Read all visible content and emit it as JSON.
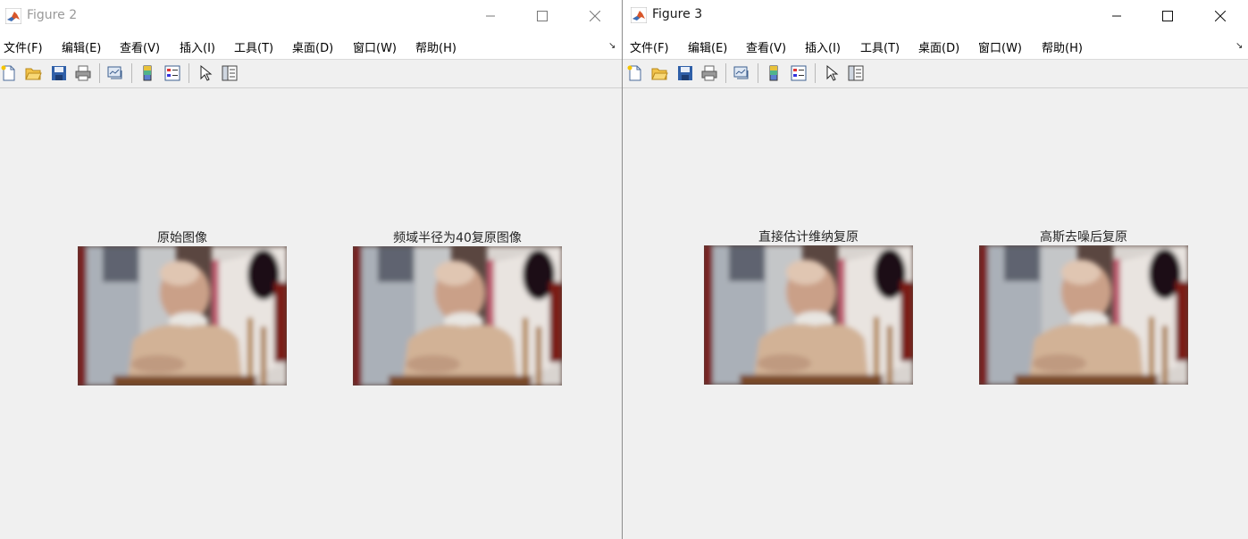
{
  "figures": [
    {
      "title": "Figure 2",
      "menu": [
        "文件(F)",
        "编辑(E)",
        "查看(V)",
        "插入(I)",
        "工具(T)",
        "桌面(D)",
        "窗口(W)",
        "帮助(H)"
      ],
      "menu_overflow": "↘",
      "toolbar_icons": [
        "new-figure-icon",
        "open-file-icon",
        "save-icon",
        "print-icon",
        "link-plot-icon",
        "insert-colorbar-icon",
        "insert-legend-icon",
        "edit-plot-arrow-icon",
        "property-inspector-icon"
      ],
      "subplots": [
        {
          "title": "原始图像"
        },
        {
          "title": "频域半径为40复原图像"
        }
      ]
    },
    {
      "title": "Figure 3",
      "menu": [
        "文件(F)",
        "编辑(E)",
        "查看(V)",
        "插入(I)",
        "工具(T)",
        "桌面(D)",
        "窗口(W)",
        "帮助(H)"
      ],
      "menu_overflow": "↘",
      "toolbar_icons": [
        "new-figure-icon",
        "open-file-icon",
        "save-icon",
        "print-icon",
        "link-plot-icon",
        "insert-colorbar-icon",
        "insert-legend-icon",
        "edit-plot-arrow-icon",
        "property-inspector-icon"
      ],
      "subplots": [
        {
          "title": "直接估计维纳复原"
        },
        {
          "title": "高斯去噪后复原"
        }
      ]
    }
  ],
  "colors": {
    "window_bg": "#f0f0f0",
    "titlebar_bg": "#ffffff",
    "inactive_title": "#999999",
    "active_title": "#1a1a1a"
  }
}
